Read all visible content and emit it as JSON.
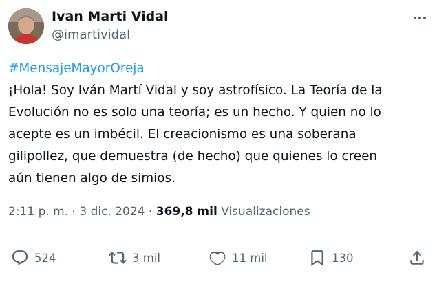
{
  "author": {
    "display_name": "Ivan Marti Vidal",
    "handle": "@imartividal"
  },
  "tweet": {
    "hashtag": "#MensajeMayorOreja",
    "text": "¡Hola! Soy Iván Martí Vidal y soy astrofísico. La Teoría de la\nEvolución no es solo una teoría; es un hecho. Y quien no lo\nacepte es un imbécil. El creacionismo es una soberana\ngilipollez, que demuestra (de hecho) que quienes lo creen\naún tienen algo de simios."
  },
  "meta": {
    "timestamp": "2:11 p. m. · 3 dic. 2024",
    "separator": " · ",
    "views_count": "369,8 mil",
    "views_label": "Visualizaciones"
  },
  "actions": {
    "replies": "524",
    "retweets": "3 mil",
    "likes": "11 mil",
    "bookmarks": "130"
  },
  "icons": [
    "more-icon",
    "reply-icon",
    "retweet-icon",
    "like-icon",
    "bookmark-icon",
    "share-icon"
  ],
  "colors": {
    "hashtag": "#1d9bf0",
    "secondary_text": "#536471",
    "primary_text": "#0f1419"
  }
}
